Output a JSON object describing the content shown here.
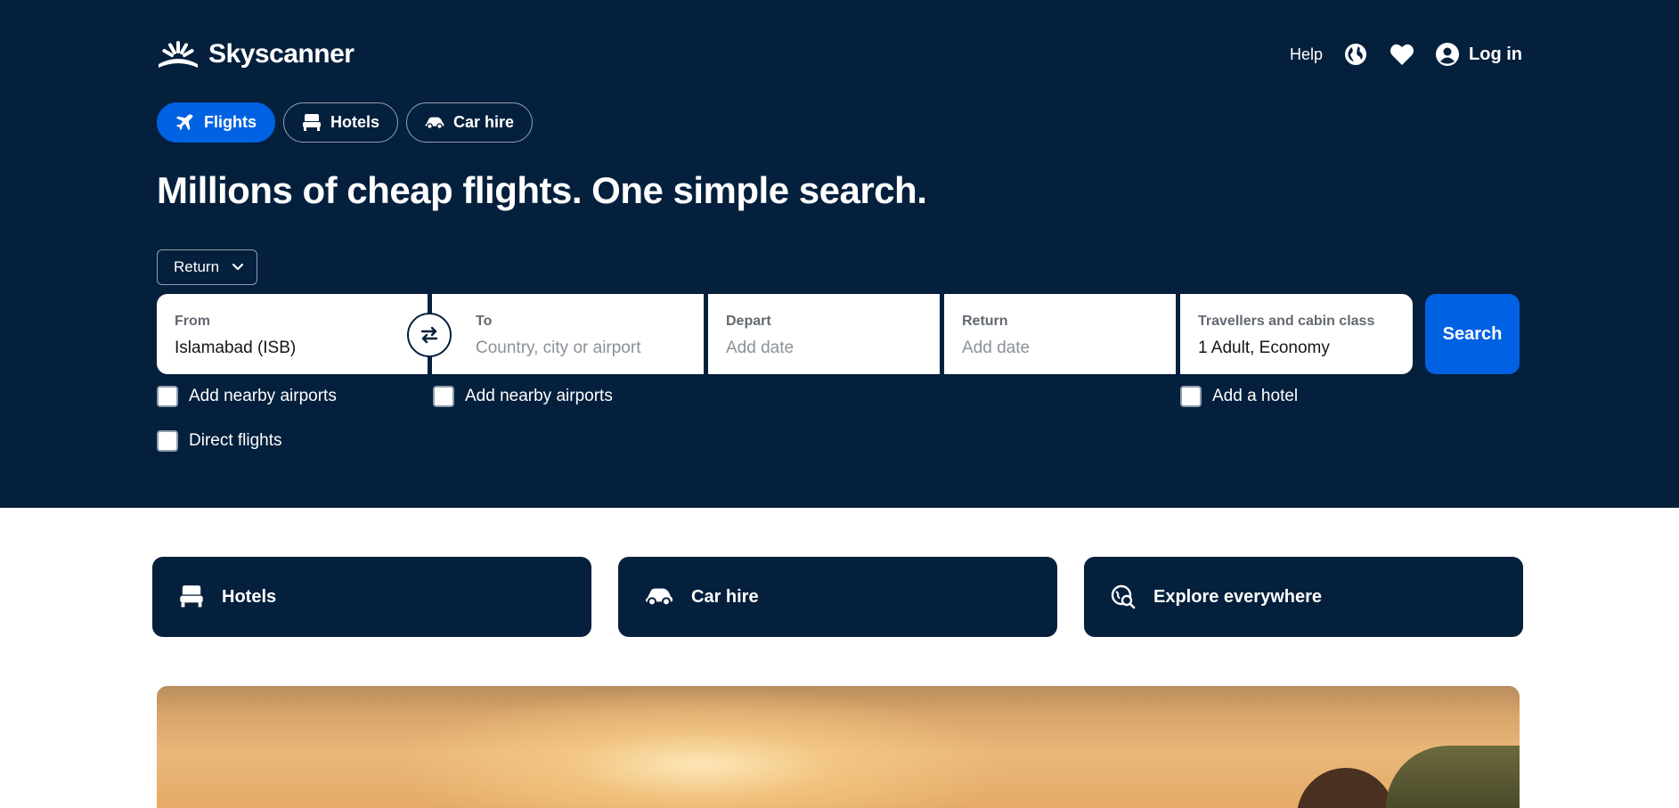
{
  "header": {
    "logo_text": "Skyscanner",
    "help_label": "Help",
    "globe_icon": "globe-icon",
    "heart_icon": "heart-icon",
    "login_label": "Log in"
  },
  "tabs": [
    {
      "label": "Flights",
      "icon": "plane-icon",
      "active": true
    },
    {
      "label": "Hotels",
      "icon": "bed-icon",
      "active": false
    },
    {
      "label": "Car hire",
      "icon": "car-icon",
      "active": false
    }
  ],
  "headline": "Millions of cheap flights. One simple search.",
  "trip_type": {
    "selected": "Return"
  },
  "search": {
    "from": {
      "label": "From",
      "value": "Islamabad (ISB)"
    },
    "to": {
      "label": "To",
      "placeholder": "Country, city or airport"
    },
    "depart": {
      "label": "Depart",
      "placeholder": "Add date"
    },
    "return": {
      "label": "Return",
      "placeholder": "Add date"
    },
    "travellers": {
      "label": "Travellers and cabin class",
      "value": "1 Adult, Economy"
    },
    "button": "Search"
  },
  "options": {
    "nearby_from": "Add nearby airports",
    "nearby_to": "Add nearby airports",
    "add_hotel": "Add a hotel",
    "direct": "Direct flights"
  },
  "quick_links": [
    {
      "label": "Hotels",
      "icon": "bed-icon"
    },
    {
      "label": "Car hire",
      "icon": "car-icon"
    },
    {
      "label": "Explore everywhere",
      "icon": "explore-icon"
    }
  ],
  "colors": {
    "navy": "#05203c",
    "brand_blue": "#0062e3",
    "white": "#ffffff"
  }
}
